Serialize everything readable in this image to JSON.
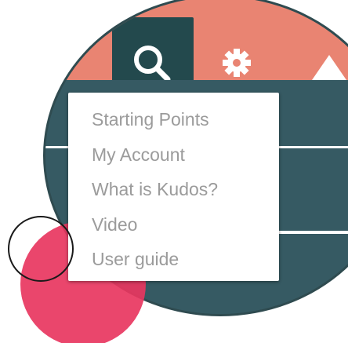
{
  "header": {
    "icons": [
      "search-icon",
      "gear-icon",
      "user-icon"
    ],
    "colors": {
      "topbar": "#e98472",
      "search_tab": "#23494d",
      "body": "#365a63"
    }
  },
  "menu": {
    "items": [
      {
        "label": "Starting Points"
      },
      {
        "label": "My Account"
      },
      {
        "label": "What is Kudos?"
      },
      {
        "label": "Video"
      },
      {
        "label": "User guide"
      }
    ],
    "text_color": "#9b9b9b"
  },
  "decor": {
    "accent_color": "#e8365f"
  }
}
